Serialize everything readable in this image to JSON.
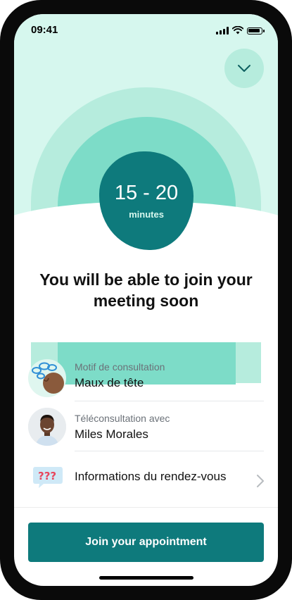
{
  "status_bar": {
    "time": "09:41"
  },
  "wait": {
    "range": "15 - 20",
    "unit": "minutes"
  },
  "heading": "You will be able to join your meeting soon",
  "details": {
    "reason": {
      "label": "Motif de consultation",
      "value": "Maux de tête",
      "icon": "headache-icon"
    },
    "practitioner": {
      "label": "Téléconsultation avec",
      "value": "Miles Morales",
      "icon": "avatar"
    },
    "info": {
      "label": "Informations du rendez-vous",
      "icon": "question-bubble-icon"
    }
  },
  "actions": {
    "join_label": "Join your appointment"
  },
  "colors": {
    "primary": "#0e7a7c",
    "mint_light": "#d6f7ee",
    "mint_mid": "#b6ecdd",
    "mint_dark": "#7ddcc8"
  }
}
